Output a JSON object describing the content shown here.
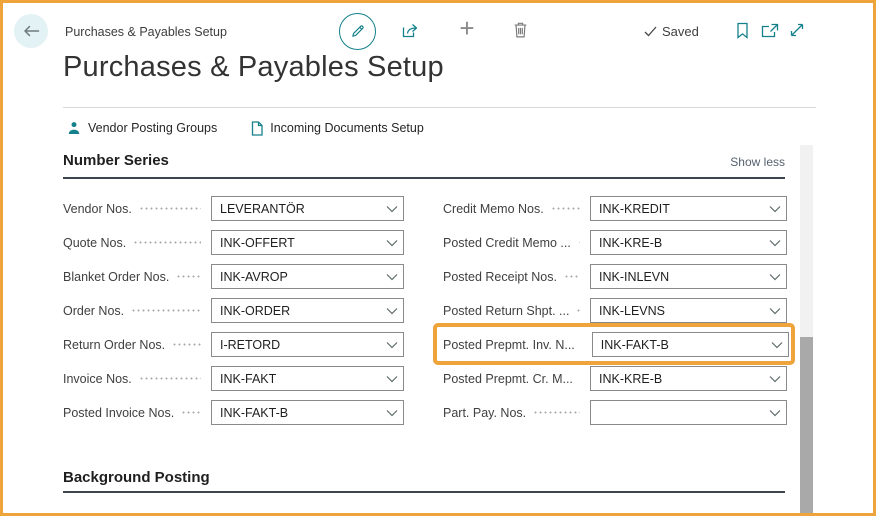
{
  "header": {
    "breadcrumb": "Purchases & Payables Setup",
    "plus_glyph": "+",
    "saved_label": "Saved"
  },
  "page": {
    "title": "Purchases & Payables Setup"
  },
  "action_bar": {
    "items": [
      {
        "label": "Vendor Posting Groups"
      },
      {
        "label": "Incoming Documents Setup"
      }
    ]
  },
  "sections": {
    "number_series": {
      "title": "Number Series",
      "show_less": "Show less"
    },
    "background_posting": {
      "title": "Background Posting"
    }
  },
  "fields": {
    "left": [
      {
        "label": "Vendor Nos.",
        "value": "LEVERANTÖR"
      },
      {
        "label": "Quote Nos.",
        "value": "INK-OFFERT"
      },
      {
        "label": "Blanket Order Nos.",
        "value": "INK-AVROP"
      },
      {
        "label": "Order Nos.",
        "value": "INK-ORDER"
      },
      {
        "label": "Return Order Nos.",
        "value": "I-RETORD"
      },
      {
        "label": "Invoice Nos.",
        "value": "INK-FAKT"
      },
      {
        "label": "Posted Invoice Nos.",
        "value": "INK-FAKT-B"
      }
    ],
    "right": [
      {
        "label": "Credit Memo Nos.",
        "value": "INK-KREDIT"
      },
      {
        "label": "Posted Credit Memo ...",
        "value": "INK-KRE-B"
      },
      {
        "label": "Posted Receipt Nos.",
        "value": "INK-INLEVN"
      },
      {
        "label": "Posted Return Shpt. ...",
        "value": "INK-LEVNS"
      },
      {
        "label": "Posted Prepmt. Inv. N...",
        "value": "INK-FAKT-B",
        "highlighted": true
      },
      {
        "label": "Posted Prepmt. Cr. M...",
        "value": "INK-KRE-B"
      },
      {
        "label": "Part. Pay. Nos.",
        "value": ""
      }
    ]
  },
  "colors": {
    "accent_teal": "#15818b",
    "annotation_orange": "#eea33b"
  }
}
